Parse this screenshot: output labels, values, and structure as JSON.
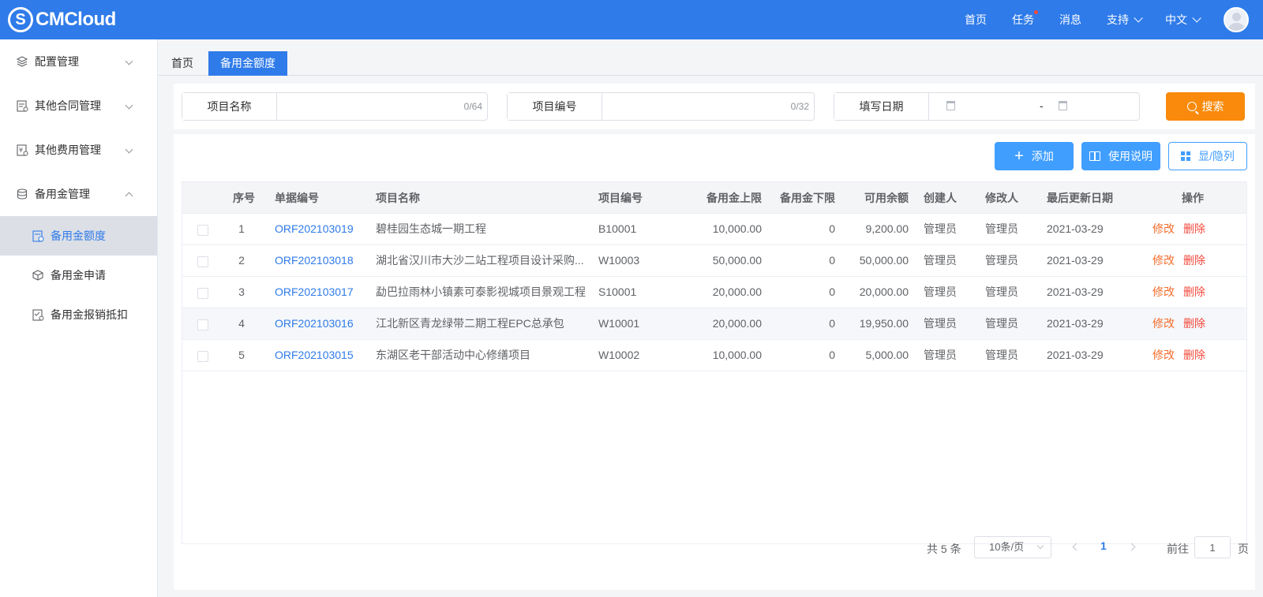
{
  "header": {
    "logo_text": "CMCloud",
    "logo_mark": "S",
    "nav": [
      "首页",
      "任务",
      "消息",
      "支持",
      "中文"
    ]
  },
  "sidebar": {
    "groups": [
      {
        "label": "配置管理",
        "icon": "layers-icon",
        "expanded": false
      },
      {
        "label": "其他合同管理",
        "icon": "contract-icon",
        "expanded": false
      },
      {
        "label": "其他费用管理",
        "icon": "fee-icon",
        "expanded": false
      },
      {
        "label": "备用金管理",
        "icon": "database-icon",
        "expanded": true
      }
    ],
    "sub_items": [
      {
        "label": "备用金额度",
        "icon": "quota-icon",
        "active": true
      },
      {
        "label": "备用金申请",
        "icon": "cube-icon",
        "active": false
      },
      {
        "label": "备用金报销抵扣",
        "icon": "reimburse-icon",
        "active": false
      }
    ]
  },
  "tabs": {
    "home": "首页",
    "active": "备用金额度"
  },
  "search": {
    "project_name_label": "项目名称",
    "project_name_count": "0/64",
    "project_code_label": "项目编号",
    "project_code_count": "0/32",
    "date_label": "填写日期",
    "date_sep": "-",
    "search_button": "搜索"
  },
  "toolbar": {
    "add": "添加",
    "help": "使用说明",
    "columns": "显/隐列"
  },
  "table": {
    "headers": [
      "序号",
      "单据编号",
      "项目名称",
      "项目编号",
      "备用金上限",
      "备用金下限",
      "可用余额",
      "创建人",
      "修改人",
      "最后更新日期",
      "操作"
    ],
    "rows": [
      {
        "no": "1",
        "doc": "ORF202103019",
        "name": "碧桂园生态城一期工程",
        "code": "B10001",
        "upper": "10,000.00",
        "lower": "0",
        "balance": "9,200.00",
        "creator": "管理员",
        "modifier": "管理员",
        "date": "2021-03-29",
        "edit": "修改",
        "del": "删除"
      },
      {
        "no": "2",
        "doc": "ORF202103018",
        "name": "湖北省汉川市大沙二站工程项目设计采购...",
        "code": "W10003",
        "upper": "50,000.00",
        "lower": "0",
        "balance": "50,000.00",
        "creator": "管理员",
        "modifier": "管理员",
        "date": "2021-03-29",
        "edit": "修改",
        "del": "删除"
      },
      {
        "no": "3",
        "doc": "ORF202103017",
        "name": "勐巴拉雨林小镇素可泰影视城项目景观工程",
        "code": "S10001",
        "upper": "20,000.00",
        "lower": "0",
        "balance": "20,000.00",
        "creator": "管理员",
        "modifier": "管理员",
        "date": "2021-03-29",
        "edit": "修改",
        "del": "删除"
      },
      {
        "no": "4",
        "doc": "ORF202103016",
        "name": "江北新区青龙绿带二期工程EPC总承包",
        "code": "W10001",
        "upper": "20,000.00",
        "lower": "0",
        "balance": "19,950.00",
        "creator": "管理员",
        "modifier": "管理员",
        "date": "2021-03-29",
        "edit": "修改",
        "del": "删除"
      },
      {
        "no": "5",
        "doc": "ORF202103015",
        "name": "东湖区老干部活动中心修缮项目",
        "code": "W10002",
        "upper": "10,000.00",
        "lower": "0",
        "balance": "5,000.00",
        "creator": "管理员",
        "modifier": "管理员",
        "date": "2021-03-29",
        "edit": "修改",
        "del": "删除"
      }
    ]
  },
  "pagination": {
    "total": "共 5 条",
    "page_size": "10条/页",
    "current": "1",
    "goto_label": "前往",
    "goto_value": "1",
    "page_suffix": "页"
  },
  "colors": {
    "primary": "#2f7be9",
    "search_btn": "#f98a0c",
    "button_blue": "#409eff",
    "delete_red": "#f5483b",
    "edit_orange": "#f56c2b"
  }
}
